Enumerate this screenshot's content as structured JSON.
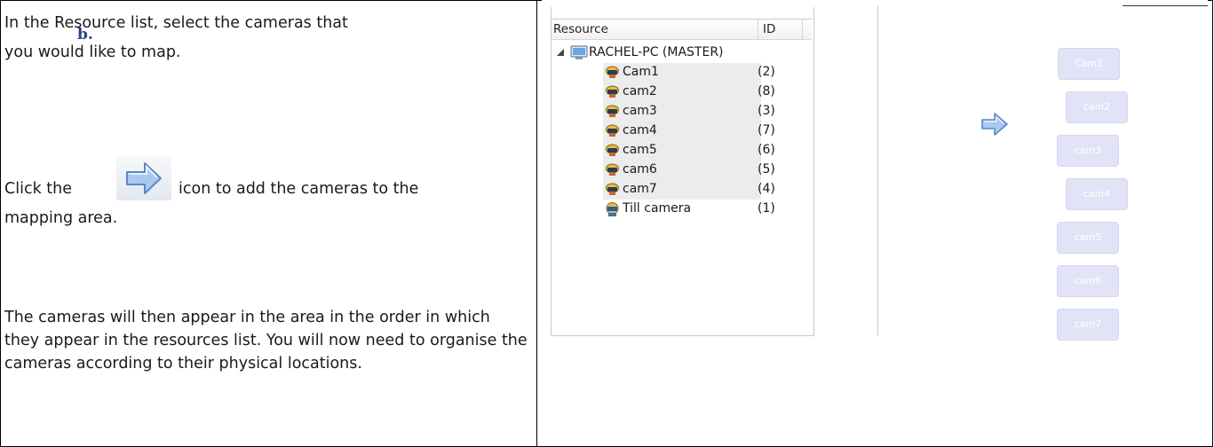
{
  "instructions": {
    "step_letter": "b.",
    "para1_line1": "In the Resource list, select the cameras that",
    "para1_line2": "you would like to map.",
    "para2_before": "Click the",
    "para2_after": "icon to add the cameras to the",
    "para2_line2": "mapping area.",
    "para3": "The cameras will then appear in the area in the order in which they appear in the resources list. You will now need to organise the cameras according to their physical locations."
  },
  "resource_tree": {
    "col_resource": "Resource",
    "col_id": "ID",
    "root_label": "RACHEL-PC (MASTER)",
    "items": [
      {
        "name": "Cam1",
        "id": "(2)",
        "selected": true
      },
      {
        "name": "cam2",
        "id": "(8)",
        "selected": true
      },
      {
        "name": "cam3",
        "id": "(3)",
        "selected": true
      },
      {
        "name": "cam4",
        "id": "(7)",
        "selected": true
      },
      {
        "name": "cam5",
        "id": "(6)",
        "selected": true
      },
      {
        "name": "cam6",
        "id": "(5)",
        "selected": true
      },
      {
        "name": "cam7",
        "id": "(4)",
        "selected": true
      },
      {
        "name": "Till camera",
        "id": "(1)",
        "selected": false
      }
    ]
  },
  "map_area": {
    "tiles": [
      "Cam1",
      "cam2",
      "cam3",
      "cam4",
      "cam5",
      "cam6",
      "cam7"
    ]
  },
  "colors": {
    "arrow_fill": "#a9c9ee",
    "arrow_stroke": "#5a88c4",
    "tile_bg": "#e3e3f7",
    "selection_bg": "#ececec"
  },
  "icons": {
    "add_arrow": "right-arrow-icon",
    "camera": "camera-icon",
    "computer": "computer-icon",
    "expand": "expand-triangle-icon"
  }
}
